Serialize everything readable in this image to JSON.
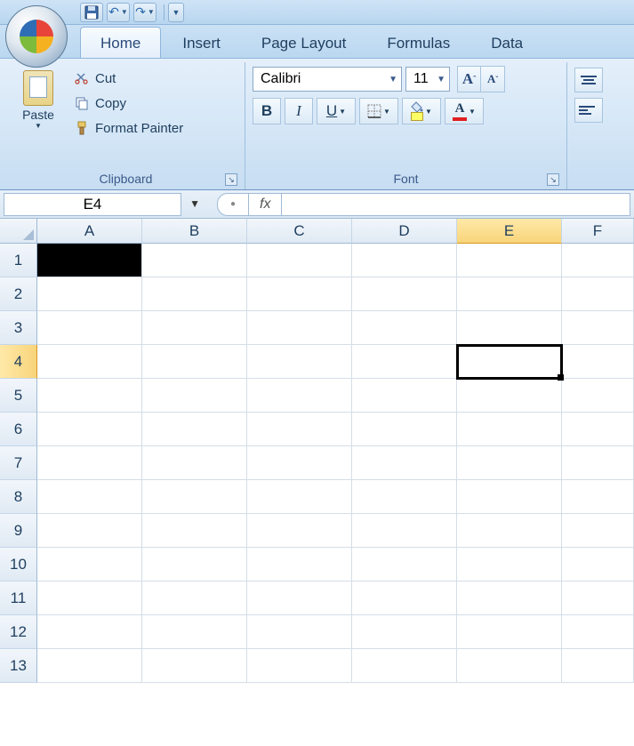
{
  "qat": {
    "save_tooltip": "Save",
    "undo_tooltip": "Undo",
    "redo_tooltip": "Redo"
  },
  "tabs": {
    "home": "Home",
    "insert": "Insert",
    "page_layout": "Page Layout",
    "formulas": "Formulas",
    "data": "Data"
  },
  "ribbon": {
    "clipboard": {
      "paste": "Paste",
      "cut": "Cut",
      "copy": "Copy",
      "format_painter": "Format Painter",
      "group_label": "Clipboard"
    },
    "font": {
      "font_name": "Calibri",
      "font_size": "11",
      "group_label": "Font"
    }
  },
  "namebox": {
    "value": "E4"
  },
  "formula_bar": {
    "fx_label": "fx",
    "value": ""
  },
  "columns": [
    "A",
    "B",
    "C",
    "D",
    "E",
    "F"
  ],
  "rows": [
    "1",
    "2",
    "3",
    "4",
    "5",
    "6",
    "7",
    "8",
    "9",
    "10",
    "11",
    "12",
    "13"
  ],
  "active_cell": "E4",
  "filled_cells": {
    "A1": {
      "fill": "black"
    }
  }
}
